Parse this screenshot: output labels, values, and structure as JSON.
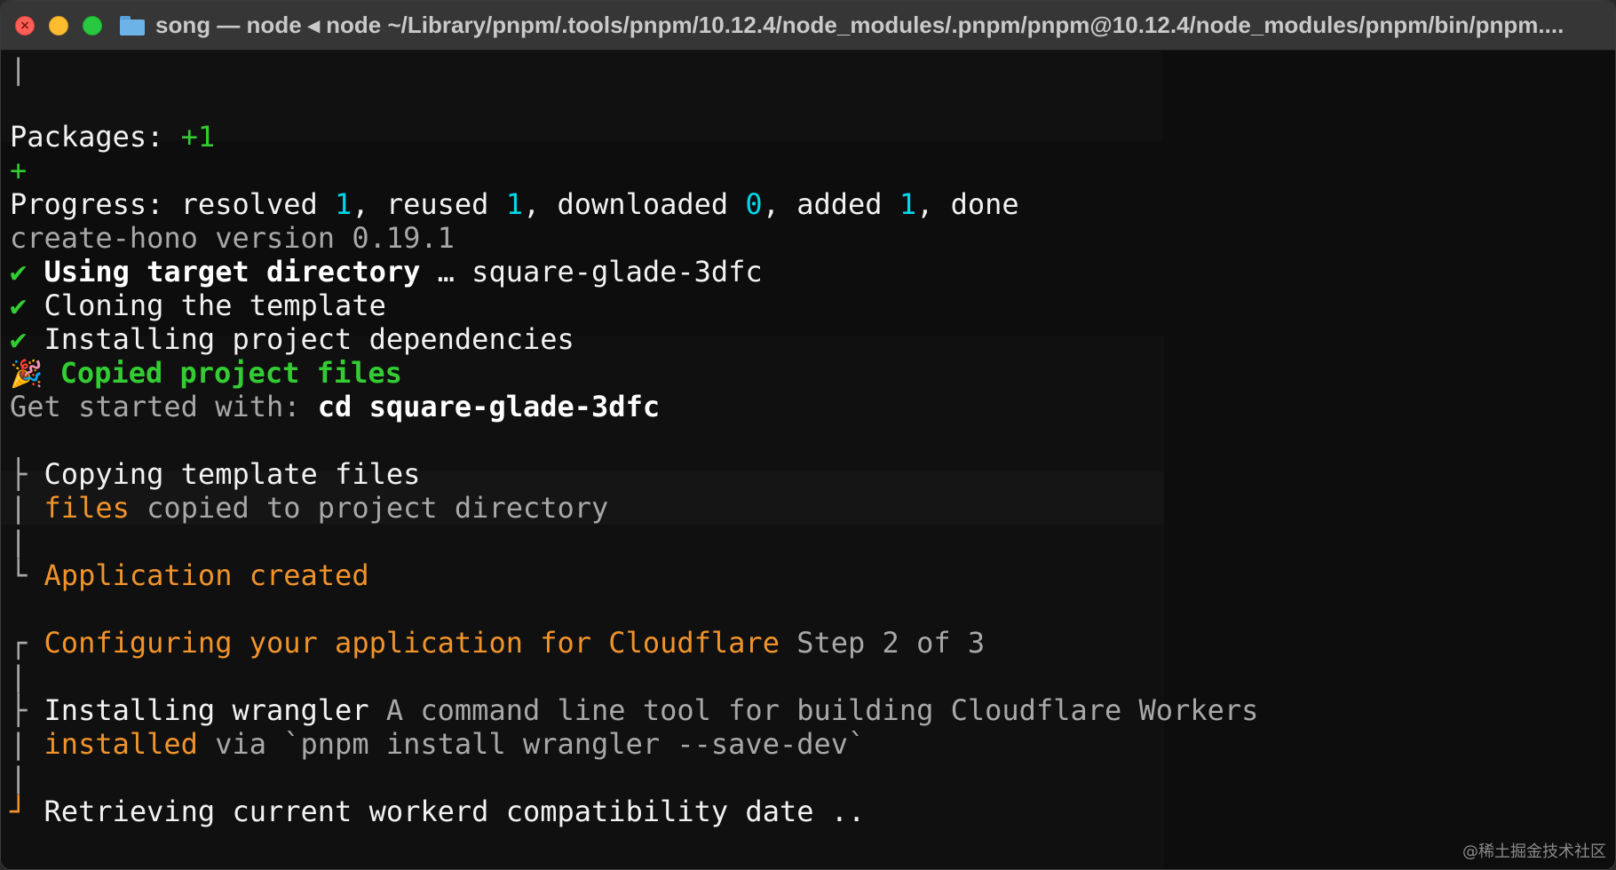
{
  "window": {
    "title": "song — node ◂ node ~/Library/pnpm/.tools/pnpm/10.12.4/node_modules/.pnpm/pnpm@10.12.4/node_modules/pnpm/bin/pnpm...."
  },
  "colors": {
    "background": "#0d0d0d",
    "green": "#33cc33",
    "cyan": "#00d7e8",
    "orange": "#f0932b",
    "gray": "#a8a8a8"
  },
  "terminal": {
    "bar_top": "|",
    "packages_label": "Packages: ",
    "packages_count": "+1",
    "plus": "+",
    "progress": {
      "label": "Progress: resolved ",
      "resolved": "1",
      "reused_label": ", reused ",
      "reused": "1",
      "downloaded_label": ", downloaded ",
      "downloaded": "0",
      "added_label": ", added ",
      "added": "1",
      "done_label": ", done"
    },
    "version_line": "create-hono version 0.19.1",
    "checks": [
      {
        "mark": "✔",
        "bold": "Using target directory",
        "rest": " … square-glade-3dfc"
      },
      {
        "mark": "✔",
        "bold": "",
        "rest": "Cloning the template"
      },
      {
        "mark": "✔",
        "bold": "",
        "rest": "Installing project dependencies"
      }
    ],
    "copied": {
      "emoji": "🎉",
      "text": "Copied project files"
    },
    "get_started": {
      "label": "Get started with: ",
      "command": "cd square-glade-3dfc"
    },
    "copying": {
      "prefix": "├",
      "text": "Copying template files"
    },
    "files_copied": {
      "prefix": "|",
      "keyword": "files",
      "rest": " copied to project directory"
    },
    "bar_mid": "|",
    "app_created": {
      "prefix": "└",
      "text": "Application created"
    },
    "configuring": {
      "prefix": "┌",
      "text": "Configuring your application for Cloudflare",
      "step": " Step 2 of 3"
    },
    "bar_cfg": "|",
    "installing": {
      "prefix": "├",
      "text": "Installing wrangler",
      "desc": " A command line tool for building Cloudflare Workers"
    },
    "installed": {
      "prefix": "|",
      "keyword": "installed",
      "rest": " via `pnpm install wrangler --save-dev`"
    },
    "bar_end": "|",
    "retrieving": {
      "prefix": "┘",
      "text": "Retrieving current workerd compatibility date .."
    }
  },
  "watermark": "@稀土掘金技术社区"
}
